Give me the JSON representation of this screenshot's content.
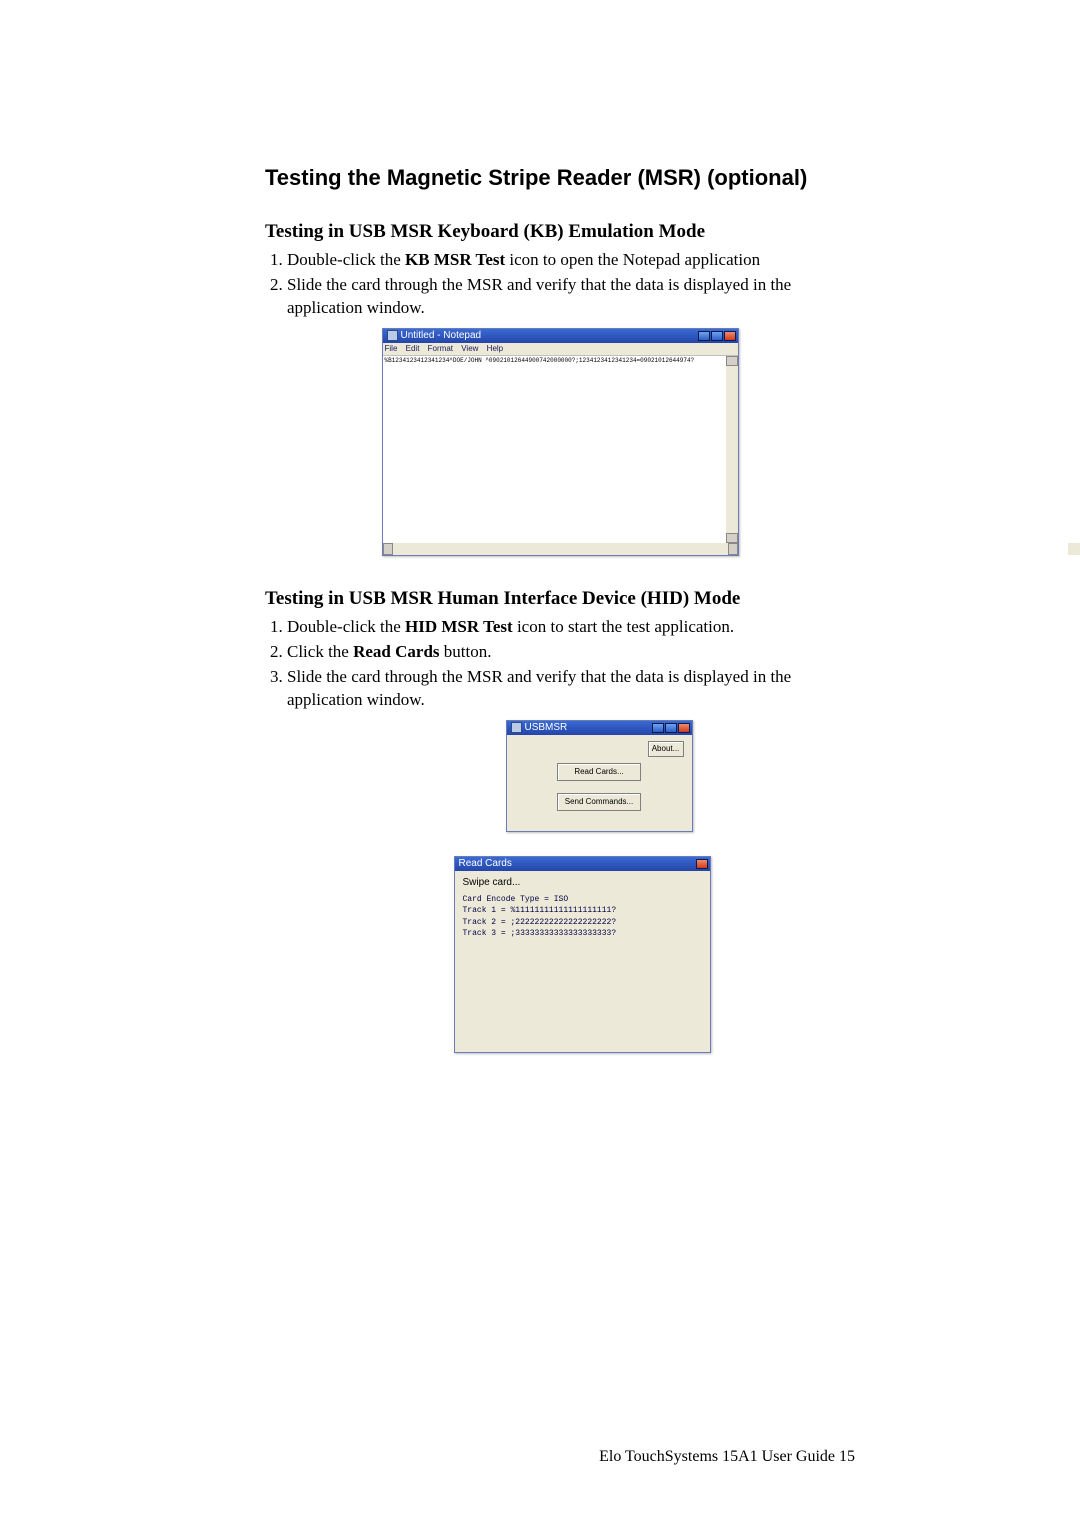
{
  "heading_main": "Testing the Magnetic Stripe Reader (MSR) (optional)",
  "section_kb": {
    "heading": "Testing in USB MSR Keyboard (KB) Emulation Mode",
    "step1_pre": "Double-click the ",
    "step1_bold": "KB MSR Test",
    "step1_post": " icon to open the Notepad application",
    "step2": "Slide the card through the MSR and verify that the data is displayed in the application window."
  },
  "notepad": {
    "title": "Untitled - Notepad",
    "menu_file": "File",
    "menu_edit": "Edit",
    "menu_format": "Format",
    "menu_view": "View",
    "menu_help": "Help",
    "content": "%B1234123412341234^DOE/JOHN ^09021012644900742000000?;1234123412341234=09021012644974?"
  },
  "section_hid": {
    "heading": "Testing in USB MSR Human Interface Device (HID) Mode",
    "step1_pre": "Double-click the ",
    "step1_bold": "HID MSR Test",
    "step1_post": " icon to start the test application.",
    "step2_pre": "Click the ",
    "step2_bold": "Read Cards",
    "step2_post": " button.",
    "step3": "Slide the card through the MSR and verify that the data is displayed in the application window."
  },
  "usbmsr": {
    "title": "USBMSR",
    "about": "About...",
    "read_cards": "Read Cards...",
    "send_commands": "Send Commands..."
  },
  "readcards": {
    "title": "Read Cards",
    "swipe": "Swipe card...",
    "body": "Card Encode Type = ISO\nTrack 1 = %11111111111111111111?\nTrack 2 = ;22222222222222222222?\nTrack 3 = ;33333333333333333333?"
  },
  "footer": "Elo TouchSystems  15A1  User Guide    15"
}
